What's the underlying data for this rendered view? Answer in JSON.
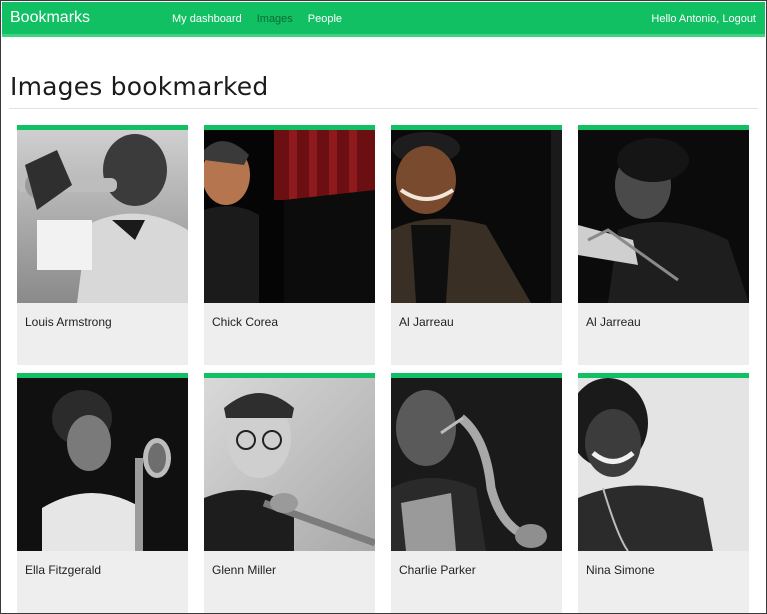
{
  "navbar": {
    "brand": "Bookmarks",
    "links": [
      {
        "label": "My dashboard",
        "active": false
      },
      {
        "label": "Images",
        "active": true
      },
      {
        "label": "People",
        "active": false
      }
    ],
    "greeting": "Hello Antonio,",
    "logout": "Logout"
  },
  "page": {
    "title": "Images bookmarked"
  },
  "images": [
    {
      "caption": "Louis Armstrong"
    },
    {
      "caption": "Chick Corea"
    },
    {
      "caption": "Al Jarreau"
    },
    {
      "caption": "Al Jarreau"
    },
    {
      "caption": "Ella Fitzgerald"
    },
    {
      "caption": "Glenn Miller"
    },
    {
      "caption": "Charlie Parker"
    },
    {
      "caption": "Nina Simone"
    }
  ],
  "colors": {
    "accent": "#12c064",
    "accent_light": "#3fd27f",
    "card_bg": "#eeeeee"
  }
}
